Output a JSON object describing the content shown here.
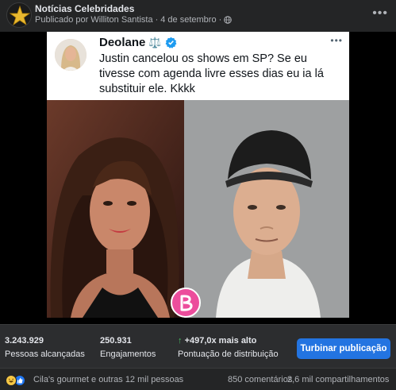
{
  "post_header": {
    "page_name": "Notícias Celebridades",
    "published_by": "Publicado por Williton Santista",
    "date": "4 de setembro",
    "privacy_icon": "globe-icon"
  },
  "tweet": {
    "author_name": "Deolane",
    "author_emoji": "⚖️",
    "verified_icon": "verified-badge-icon",
    "text": "Justin cancelou os shows em SP? Se eu tivesse com agenda livre esses dias eu ia lá substituir ele. Kkkk"
  },
  "stats": {
    "reach_value": "3.243.929",
    "reach_label": "Pessoas alcançadas",
    "engagement_value": "250.931",
    "engagement_label": "Engajamentos",
    "distribution_value": "+497,0x mais alto",
    "distribution_label": "Pontuação de distribuição",
    "boost_label": "Turbinar publicação"
  },
  "footer": {
    "reactors": "Cila's gourmet e outras 12 mil pessoas",
    "comments": "850 comentários",
    "shares": "2,6 mil compartilhamentos"
  },
  "colors": {
    "accent": "#2374e1",
    "positive": "#45bd62",
    "verified": "#1d9bf0"
  }
}
